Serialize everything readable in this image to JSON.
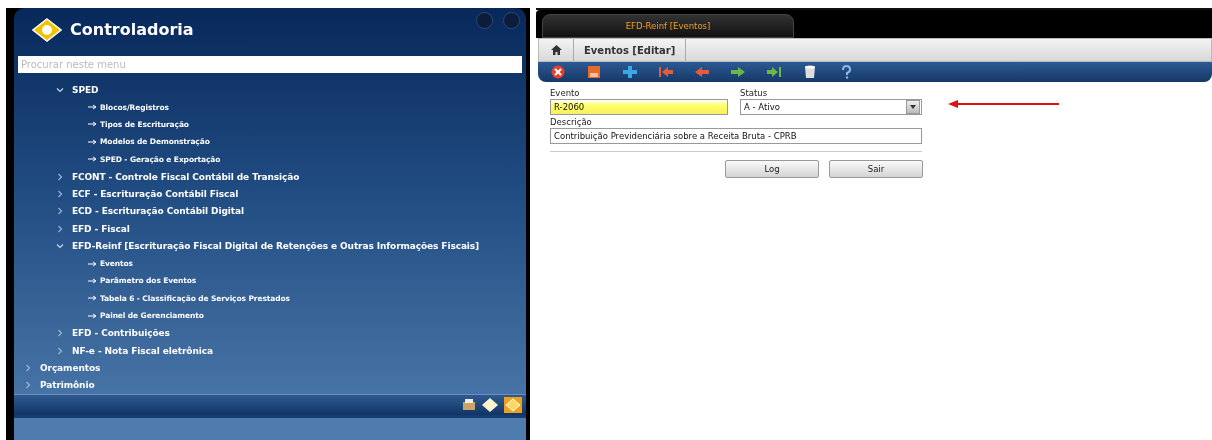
{
  "sidebar": {
    "title": "Controladoria",
    "search": {
      "placeholder": "Procurar neste menu"
    },
    "tree": [
      {
        "label": "SPED",
        "expanded": true,
        "children": [
          {
            "label": "Blocos/Registros"
          },
          {
            "label": "Tipos de Escrituração"
          },
          {
            "label": "Modelos de Demonstração"
          },
          {
            "label": "SPED - Geração e Exportação"
          }
        ]
      },
      {
        "label": "FCONT - Controle Fiscal Contábil de Transição",
        "expanded": false
      },
      {
        "label": "ECF - Escrituração Contábil Fiscal",
        "expanded": false
      },
      {
        "label": "ECD - Escrituração Contábil Digital",
        "expanded": false
      },
      {
        "label": "EFD - Fiscal",
        "expanded": false
      },
      {
        "label": "EFD-Reinf [Escrituração Fiscal Digital de Retenções e Outras Informações Fiscais]",
        "expanded": true,
        "children": [
          {
            "label": "Eventos"
          },
          {
            "label": "Parâmetro dos Eventos"
          },
          {
            "label": "Tabela 6 - Classificação de Serviços Prestados"
          },
          {
            "label": "Painel de Gerenciamento"
          }
        ]
      },
      {
        "label": "EFD - Contribuições",
        "expanded": false
      },
      {
        "label": "NF-e - Nota Fiscal eletrônica",
        "expanded": false
      }
    ],
    "root_items": [
      {
        "label": "Orçamentos",
        "expanded": false
      },
      {
        "label": "Patrimônio",
        "expanded": false
      }
    ]
  },
  "main": {
    "tab": "EFD-Reinf [Eventos]",
    "breadcrumb": "Eventos [Editar]",
    "fields": [
      {
        "label": "Evento",
        "value": "R-2060",
        "kind": "text",
        "required": true
      },
      {
        "label": "Status",
        "value": "A - Ativo",
        "kind": "select",
        "required": false
      },
      {
        "label": "Descrição",
        "value": "Contribuição Previdenciária sobre a Receita Bruta - CPRB",
        "kind": "text",
        "required": false
      }
    ],
    "buttons": [
      "Log",
      "Sair"
    ]
  }
}
